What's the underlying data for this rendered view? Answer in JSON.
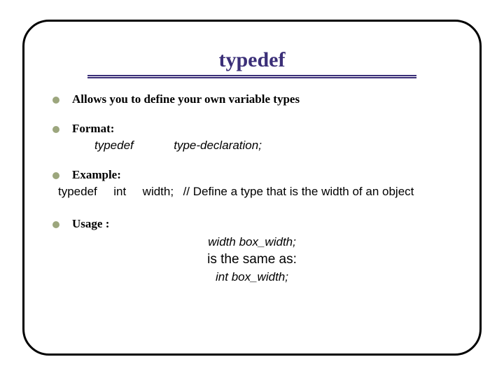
{
  "title": "typedef",
  "bullets": {
    "b1": "Allows you to define your own variable types",
    "b2": "Format:",
    "b2_sub_a": "typedef",
    "b2_sub_b": "type-declaration;",
    "b3": "Example:",
    "b3_code_a": "typedef",
    "b3_code_b": "int",
    "b3_code_c": "width;",
    "b3_code_comment": "// Define a type that is the width of an object",
    "b4": "Usage :",
    "b4_line1": "width box_width;",
    "b4_line2": "is the same as:",
    "b4_line3": "int box_width;"
  }
}
